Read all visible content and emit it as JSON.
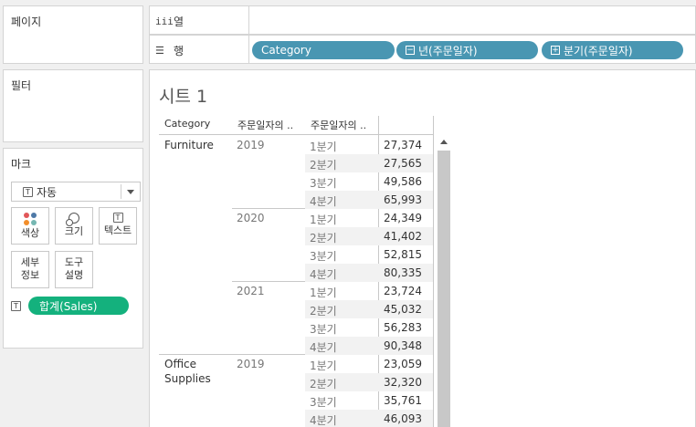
{
  "panes": {
    "pages": "페이지",
    "filters": "필터",
    "marks": "마크"
  },
  "marks": {
    "type_label": "자동",
    "color_label": "색상",
    "size_label": "크기",
    "text_label": "텍스트",
    "detail_label_1": "세부",
    "detail_label_2": "정보",
    "tooltip_label_1": "도구",
    "tooltip_label_2": "설명",
    "sum_pill": "합계(Sales)",
    "dot_colors": [
      "#e15759",
      "#4e79a7",
      "#f28e2b",
      "#76b7b2"
    ]
  },
  "shelves": {
    "columns_label": "열",
    "rows_label": "행",
    "rows_pills": [
      "Category",
      "년(주문일자)",
      "분기(주문일자)"
    ],
    "pill_color": "#4996b2",
    "sum_pill_color": "#14b17d"
  },
  "sheet": {
    "title": "시트 1",
    "headers": [
      "Category",
      "주문일자의 ..",
      "주문일자의 .."
    ]
  },
  "table": {
    "categories": [
      "Furniture",
      "Office\nSupplies"
    ],
    "years": [
      "2019",
      "2020",
      "2021",
      "2019"
    ],
    "quarters": [
      "1분기",
      "2분기",
      "3분기",
      "4분기"
    ],
    "values": [
      "27,374",
      "27,565",
      "49,586",
      "65,993",
      "24,349",
      "41,402",
      "52,815",
      "80,335",
      "23,724",
      "45,032",
      "56,283",
      "90,348",
      "23,059",
      "32,320",
      "35,761",
      "46,093"
    ]
  }
}
